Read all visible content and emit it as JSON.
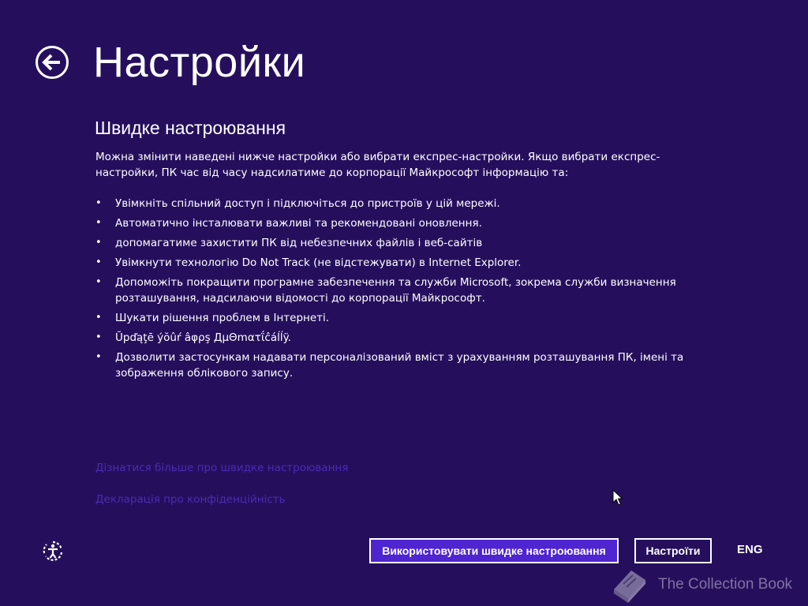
{
  "header": {
    "title": "Настройки",
    "back_icon": "back-arrow-circle-icon"
  },
  "section": {
    "title": "Швидке настроювання",
    "intro": "Можна змінити наведені нижче настройки або вибрати експрес-настройки. Якщо вибрати експрес-настройки, ПК час від часу надсилатиме до корпорації Майкрософт інформацію та:",
    "bullets": [
      "Увімкніть спільний доступ і підключіться до пристроїв у цій мережі.",
      "Автоматично інсталювати важливі та рекомендовані оновлення.",
      "допомагатиме захистити ПК від небезпечних файлів і веб-сайтів",
      "Увімкнути технологію Do Not Track (не відстежувати) в Internet Explorer.",
      "Допоможіть покращити програмне забезпечення та служби Microsoft, зокрема служби визначення розташування, надсилаючи відомості до корпорації Майкрософт.",
      "Шукати рішення проблем в Інтернеті.",
      "Ŭpďąţē ýŏûŕ âφρş ДµΘmατΐĉáĺĺÿ.",
      "Дозволити застосункам надавати персоналізований вміст з урахуванням розташування ПК, імені та зображення облікового запису."
    ]
  },
  "links": {
    "learn_more": "Дізнатися більше про швидке настроювання",
    "privacy": "Декларація про конфіденційність"
  },
  "footer": {
    "express_button": "Використовувати швидке настроювання",
    "customize_button": "Настроїти",
    "language": "ENG",
    "ease_of_access_icon": "ease-of-access-icon"
  },
  "watermark": {
    "text": "The Collection Book",
    "icon": "book-icon"
  },
  "colors": {
    "background": "#250f5d",
    "accent_button": "#4f24d1",
    "link": "#4d2ab4"
  }
}
